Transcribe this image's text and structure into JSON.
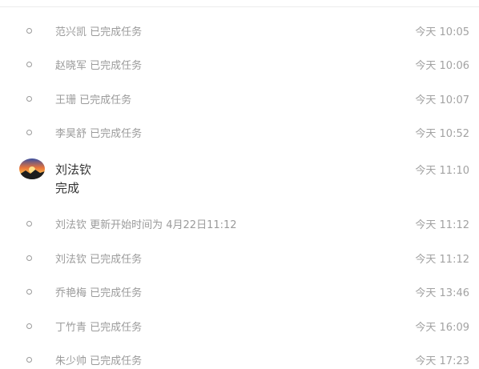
{
  "feed": {
    "events_before": [
      {
        "text": "范兴凯 已完成任务",
        "time": "今天 10:05"
      },
      {
        "text": "赵晓军 已完成任务",
        "time": "今天 10:06"
      },
      {
        "text": "王珊 已完成任务",
        "time": "今天 10:07"
      },
      {
        "text": "李昊舒 已完成任务",
        "time": "今天 10:52"
      }
    ],
    "comment": {
      "author": "刘法钦",
      "body": "完成",
      "time": "今天 11:10",
      "avatar_icon": "sunset-avatar-icon"
    },
    "events_after": [
      {
        "text": "刘法钦 更新开始时间为 4月22日11:12",
        "time": "今天 11:12"
      },
      {
        "text": "刘法钦 已完成任务",
        "time": "今天 11:12"
      },
      {
        "text": "乔艳梅 已完成任务",
        "time": "今天 13:46"
      },
      {
        "text": "丁竹青 已完成任务",
        "time": "今天 16:09"
      },
      {
        "text": "朱少帅 已完成任务",
        "time": "今天 17:23"
      }
    ]
  },
  "colors": {
    "secondary_text": "#9b9b9b",
    "primary_text": "#333333",
    "bullet": "#9a9a9a"
  }
}
